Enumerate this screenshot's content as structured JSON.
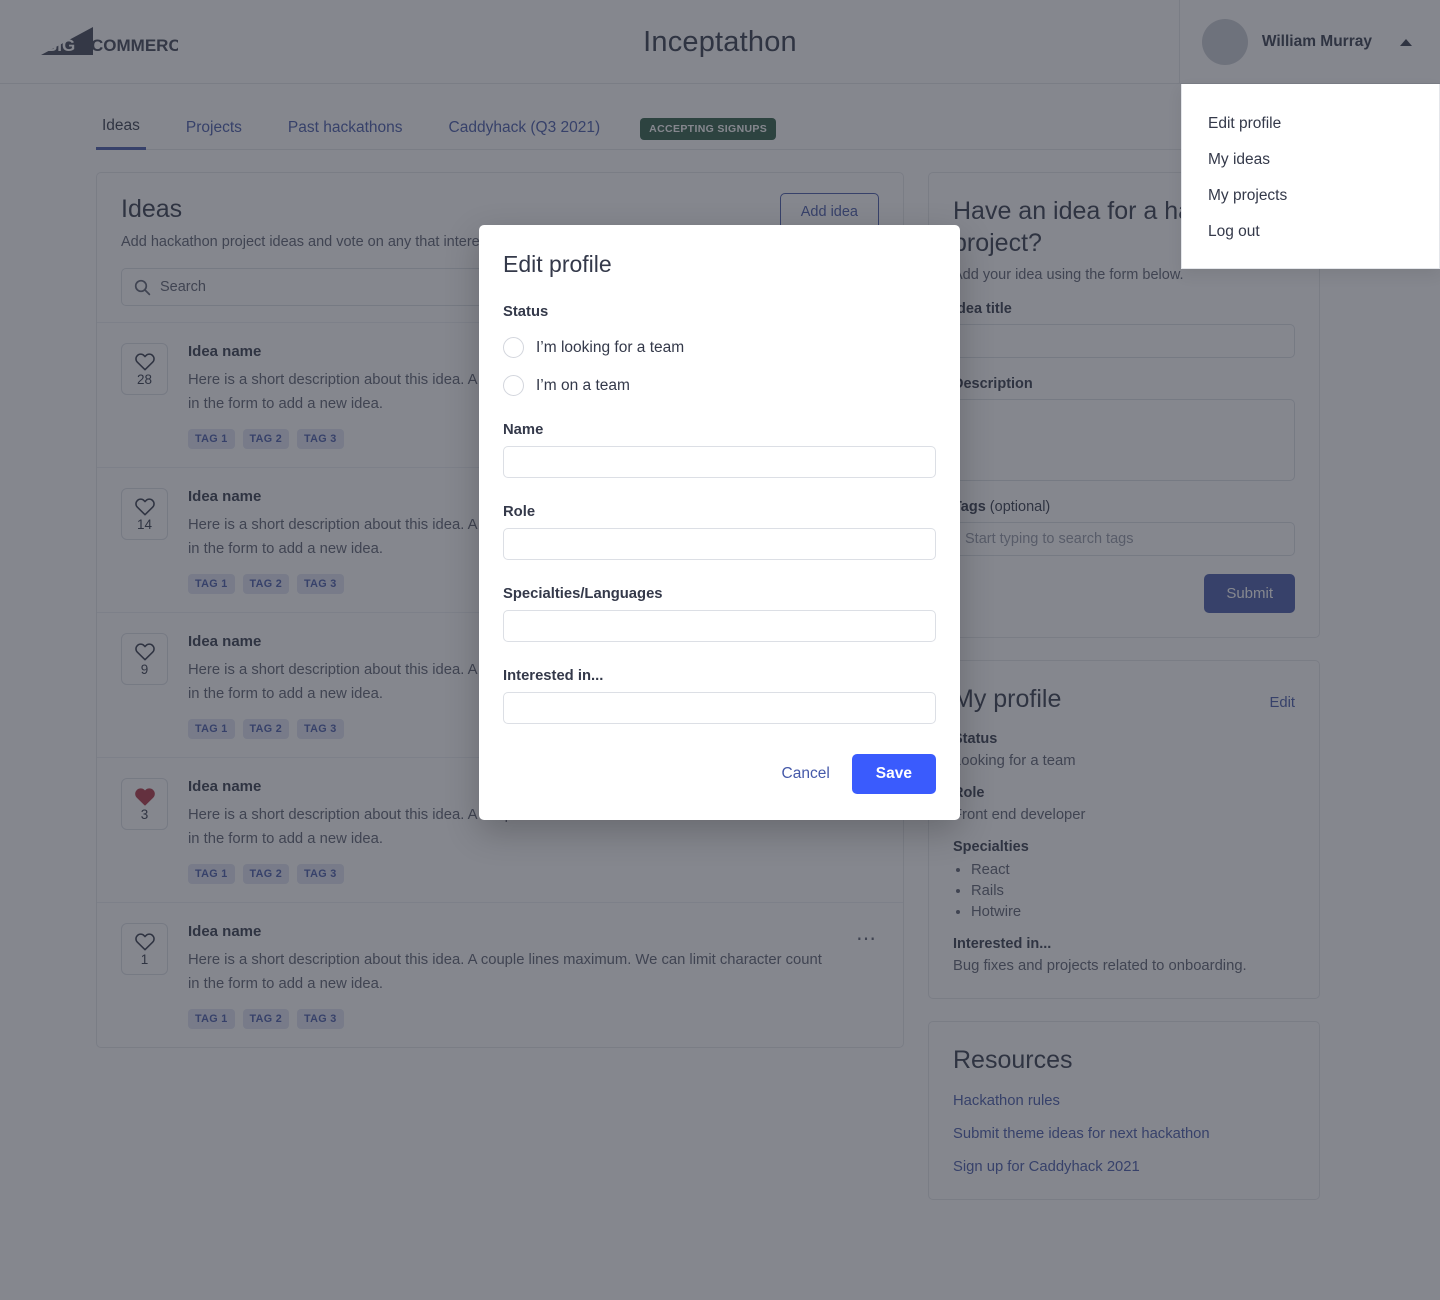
{
  "header": {
    "logo_text_1": "BIG",
    "logo_text_2": "COMMERCE",
    "app_title": "Inceptathon",
    "user_name": "William Murray"
  },
  "user_menu": {
    "items": [
      {
        "label": "Edit profile"
      },
      {
        "label": "My ideas"
      },
      {
        "label": "My projects"
      },
      {
        "label": "Log out"
      }
    ]
  },
  "tabs": [
    {
      "label": "Ideas",
      "active": true
    },
    {
      "label": "Projects",
      "active": false
    },
    {
      "label": "Past hackathons",
      "active": false
    },
    {
      "label": "Caddyhack (Q3 2021)",
      "active": false
    }
  ],
  "status_badge": "ACCEPTING SIGNUPS",
  "ideas_panel": {
    "title": "Ideas",
    "subtitle": "Add hackathon project ideas and vote on any that interest you.",
    "add_button": "Add idea",
    "search_placeholder": "Search",
    "rows": [
      {
        "votes": "28",
        "name": "Idea name",
        "description": "Here is a short description about this idea. A couple lines maximum. We can limit character count in the form to add a new idea.",
        "tags": [
          "TAG 1",
          "TAG 2",
          "TAG 3"
        ],
        "liked": false
      },
      {
        "votes": "14",
        "name": "Idea name",
        "description": "Here is a short description about this idea. A couple lines maximum. We can limit character count in the form to add a new idea.",
        "tags": [
          "TAG 1",
          "TAG 2",
          "TAG 3"
        ],
        "liked": false
      },
      {
        "votes": "9",
        "name": "Idea name",
        "description": "Here is a short description about this idea. A couple lines maximum. We can limit character count in the form to add a new idea.",
        "tags": [
          "TAG 1",
          "TAG 2",
          "TAG 3"
        ],
        "liked": false
      },
      {
        "votes": "3",
        "name": "Idea name",
        "description": "Here is a short description about this idea. A couple lines maximum. We can limit character count in the form to add a new idea.",
        "tags": [
          "TAG 1",
          "TAG 2",
          "TAG 3"
        ],
        "liked": true
      },
      {
        "votes": "1",
        "name": "Idea name",
        "description": "Here is a short description about this idea. A couple lines maximum. We can limit character count in the form to add a new idea.",
        "tags": [
          "TAG 1",
          "TAG 2",
          "TAG 3"
        ],
        "liked": false
      }
    ]
  },
  "idea_form": {
    "title": "Have an idea for a hackathon project?",
    "subtitle": "Add your idea using the form below.",
    "title_label": "Idea title",
    "title_value": "",
    "description_label": "Description",
    "description_value": "",
    "tags_label": "Tags",
    "tags_label_optional": " (optional)",
    "tags_placeholder": "Start typing to search tags",
    "submit_label": "Submit"
  },
  "profile_card": {
    "title": "My profile",
    "edit_label": "Edit",
    "status_label": "Status",
    "status_value": "Looking for a team",
    "role_label": "Role",
    "role_value": "Front end developer",
    "specialties_label": "Specialties",
    "specialties": [
      "React",
      "Rails",
      "Hotwire"
    ],
    "interested_label": "Interested in...",
    "interested_value": "Bug fixes and projects related to onboarding."
  },
  "resources_card": {
    "title": "Resources",
    "links": [
      {
        "label": "Hackathon rules"
      },
      {
        "label": "Submit theme ideas for next hackathon"
      },
      {
        "label": "Sign up for Caddyhack 2021"
      }
    ]
  },
  "modal": {
    "title": "Edit profile",
    "status_label": "Status",
    "radio_1": "I’m looking for a team",
    "radio_2": "I’m on a team",
    "name_label": "Name",
    "name_value": "",
    "role_label": "Role",
    "role_value": "",
    "specialties_label": "Specialties/Languages",
    "specialties_value": "",
    "interested_label": "Interested in...",
    "interested_value": "",
    "cancel_label": "Cancel",
    "save_label": "Save"
  },
  "colors": {
    "accent_blue": "#4559a9",
    "save_blue": "#3a5bfd",
    "badge_green": "#2f5d47",
    "heart_red": "#b03444",
    "text_dark": "#34394a"
  }
}
